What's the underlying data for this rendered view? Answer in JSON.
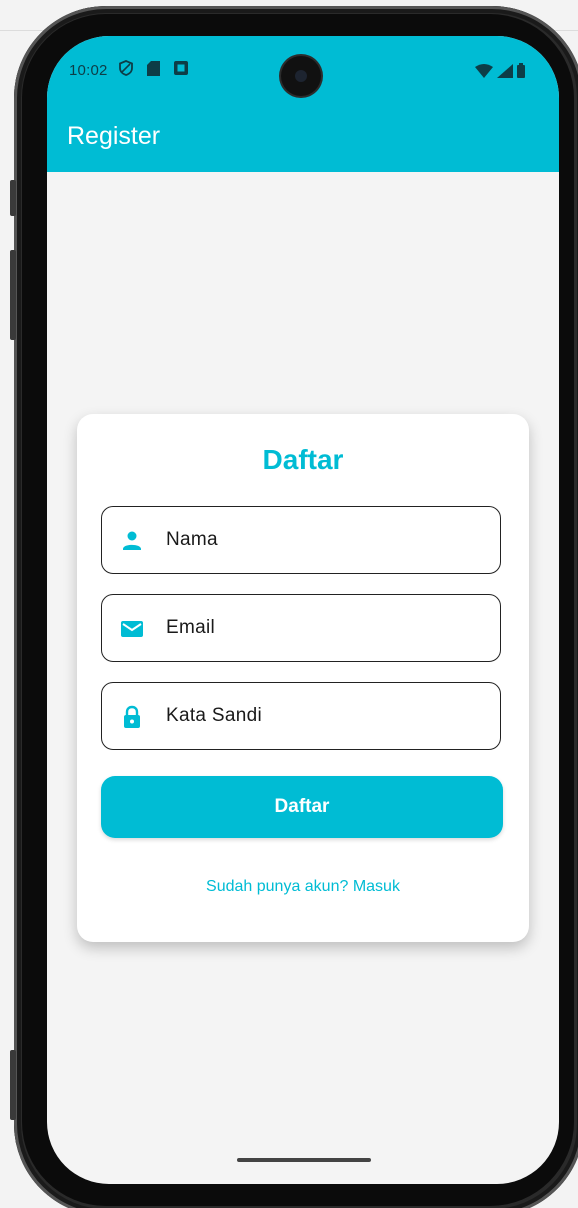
{
  "status_bar": {
    "time": "10:02",
    "left_icons": [
      "shield-icon",
      "sd-card-icon",
      "notification-icon"
    ],
    "right_icons": [
      "wifi-icon",
      "signal-icon",
      "battery-icon"
    ]
  },
  "app_bar": {
    "title": "Register",
    "color": "#00bcd4"
  },
  "card": {
    "title": "Daftar",
    "fields": [
      {
        "icon": "person-icon",
        "placeholder": "Nama"
      },
      {
        "icon": "email-icon",
        "placeholder": "Email"
      },
      {
        "icon": "lock-icon",
        "placeholder": "Kata Sandi"
      }
    ],
    "submit_label": "Daftar",
    "login_link": "Sudah punya akun? Masuk"
  }
}
